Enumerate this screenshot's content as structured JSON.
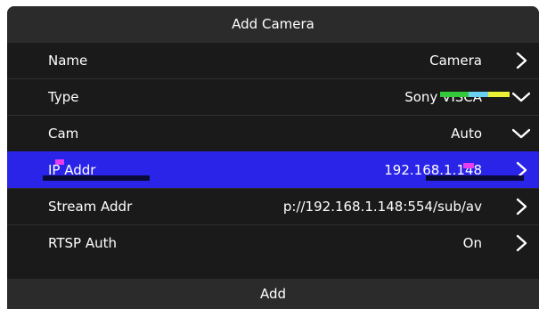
{
  "dialog": {
    "title": "Add Camera",
    "add_label": "Add"
  },
  "rows": [
    {
      "label": "Name",
      "value": "Camera",
      "icon": "chevron-right-icon"
    },
    {
      "label": "Type",
      "value": "Sony VISCA",
      "icon": "chevron-down-icon"
    },
    {
      "label": "Cam",
      "value": "Auto",
      "icon": "chevron-down-icon"
    },
    {
      "label": "IP Addr",
      "value": "192.168.1.148",
      "icon": "chevron-right-icon"
    },
    {
      "label": "Stream Addr",
      "value": "p://192.168.1.148:554/sub/av",
      "icon": "chevron-right-icon"
    },
    {
      "label": "RTSP Auth",
      "value": "On",
      "icon": "chevron-right-icon"
    }
  ],
  "colors": {
    "background": "#1a1a1a",
    "header": "#2b2b2b",
    "selected": "#2a24e8",
    "text": "#ffffff"
  }
}
